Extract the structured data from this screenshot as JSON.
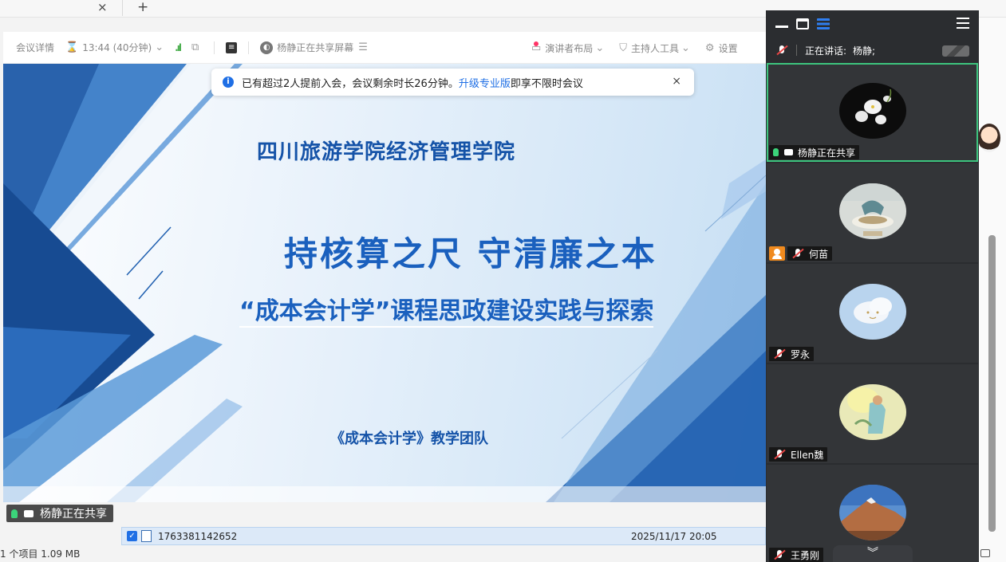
{
  "browser": {
    "close_glyph": "×",
    "newtab_glyph": "+"
  },
  "toolbar": {
    "meeting_details": "会议详情",
    "time": "13:44 (40分钟)",
    "sharing_status": "杨静正在共享屏幕",
    "presenter_layout": "演讲者布局",
    "host_tools": "主持人工具",
    "settings": "设置"
  },
  "notice": {
    "text_before": "已有超过2人提前入会，会议剩余时长26分钟。",
    "link": "升级专业版",
    "text_after": "即享不限时会议",
    "close": "×"
  },
  "slide": {
    "school": "四川旅游学院经济管理学院",
    "headline": "持核算之尺   守清廉之本",
    "course_title": "“成本会计学”课程思政建设实践与探索",
    "team": "《成本会计学》教学团队",
    "colors": {
      "title_blue": "#1a60be",
      "shape_blue": "#1f5fb0"
    }
  },
  "share_tag": {
    "label": "杨静正在共享"
  },
  "file_explorer": {
    "file_name": "1763381142652",
    "modified": "2025/11/17 20:05",
    "status": "1 个项目  1.09 MB"
  },
  "panel": {
    "speaking_label": "正在讲话:",
    "speaking_name": "杨静;",
    "participants": [
      {
        "name": "杨静正在共享",
        "role": "sharing",
        "avatar": "white-orchid"
      },
      {
        "name": "何苗",
        "role": "host",
        "avatar": "sea-bowl"
      },
      {
        "name": "罗永",
        "role": "muted",
        "avatar": "sky-cloud-smile"
      },
      {
        "name": "Ellen魏",
        "role": "muted",
        "avatar": "girl-painting"
      },
      {
        "name": "王勇刚",
        "role": "muted",
        "avatar": "mountain"
      }
    ],
    "expand_glyph": "︾"
  }
}
